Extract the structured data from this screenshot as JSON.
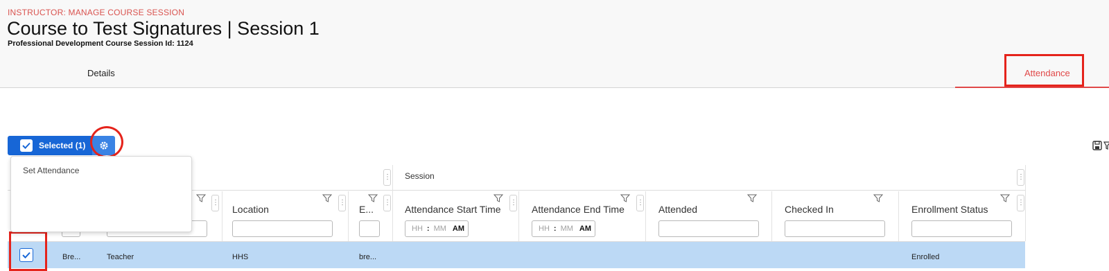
{
  "header": {
    "eyebrow": "INSTRUCTOR: MANAGE COURSE SESSION",
    "title": "Course to Test Signatures | Session 1",
    "subtitle": "Professional Development Course Session Id: 1124"
  },
  "tabs": [
    {
      "label": "Details",
      "active": false
    },
    {
      "label": "Attendance",
      "active": true
    }
  ],
  "toolbar": {
    "selected_label": "Selected (1)",
    "menu_items": [
      "Set Attendance"
    ]
  },
  "grid": {
    "group_label": "Session",
    "columns": [
      "Location",
      "E...",
      "Attendance Start Time",
      "Attendance End Time",
      "Attended",
      "Checked In",
      "Enrollment Status"
    ],
    "time_filter": {
      "hh": "HH",
      "mm": "MM",
      "separator": ":",
      "ampm": "AM"
    },
    "rows": [
      {
        "checked": true,
        "c1": "Bre...",
        "c2": "Teacher",
        "location": "HHS",
        "email": "bre...",
        "start": "",
        "end": "",
        "attended": "",
        "checked_in": "",
        "status": "Enrolled"
      }
    ]
  },
  "colors": {
    "accent_red": "#e04848",
    "primary_blue": "#1766d6",
    "row_selected": "#bcd9f5",
    "annotation_red": "#e5231b"
  },
  "icons": [
    "check-icon",
    "gear-icon",
    "funnel-icon",
    "kebab-icon",
    "save-icon"
  ]
}
